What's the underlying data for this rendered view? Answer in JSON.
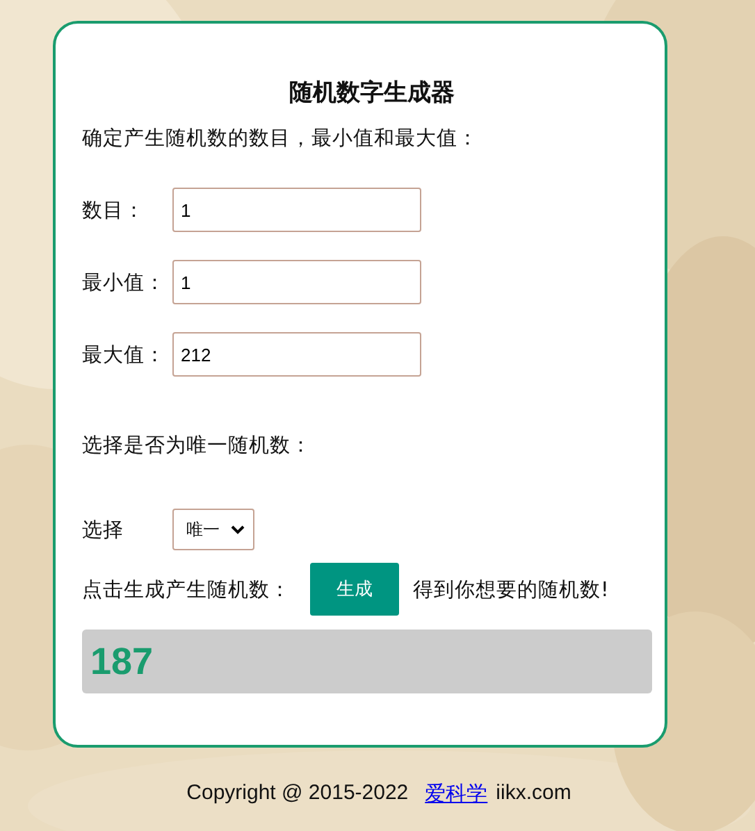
{
  "card": {
    "title": "随机数字生成器",
    "intro": "确定产生随机数的数目，最小值和最大值：",
    "fields": [
      {
        "label": "数目：",
        "value": "1"
      },
      {
        "label": "最小值：",
        "value": "1"
      },
      {
        "label": "最大值：",
        "value": "212"
      }
    ],
    "unique_prompt": "选择是否为唯一随机数：",
    "select": {
      "label": "选择",
      "value": "唯一"
    },
    "generate": {
      "before": "点击生成产生随机数：",
      "button": "生成",
      "after": "得到你想要的随机数!"
    },
    "result": "187"
  },
  "footer": {
    "copyright": "Copyright @ 2015-2022",
    "link": "爱科学",
    "site": "iikx.com"
  }
}
